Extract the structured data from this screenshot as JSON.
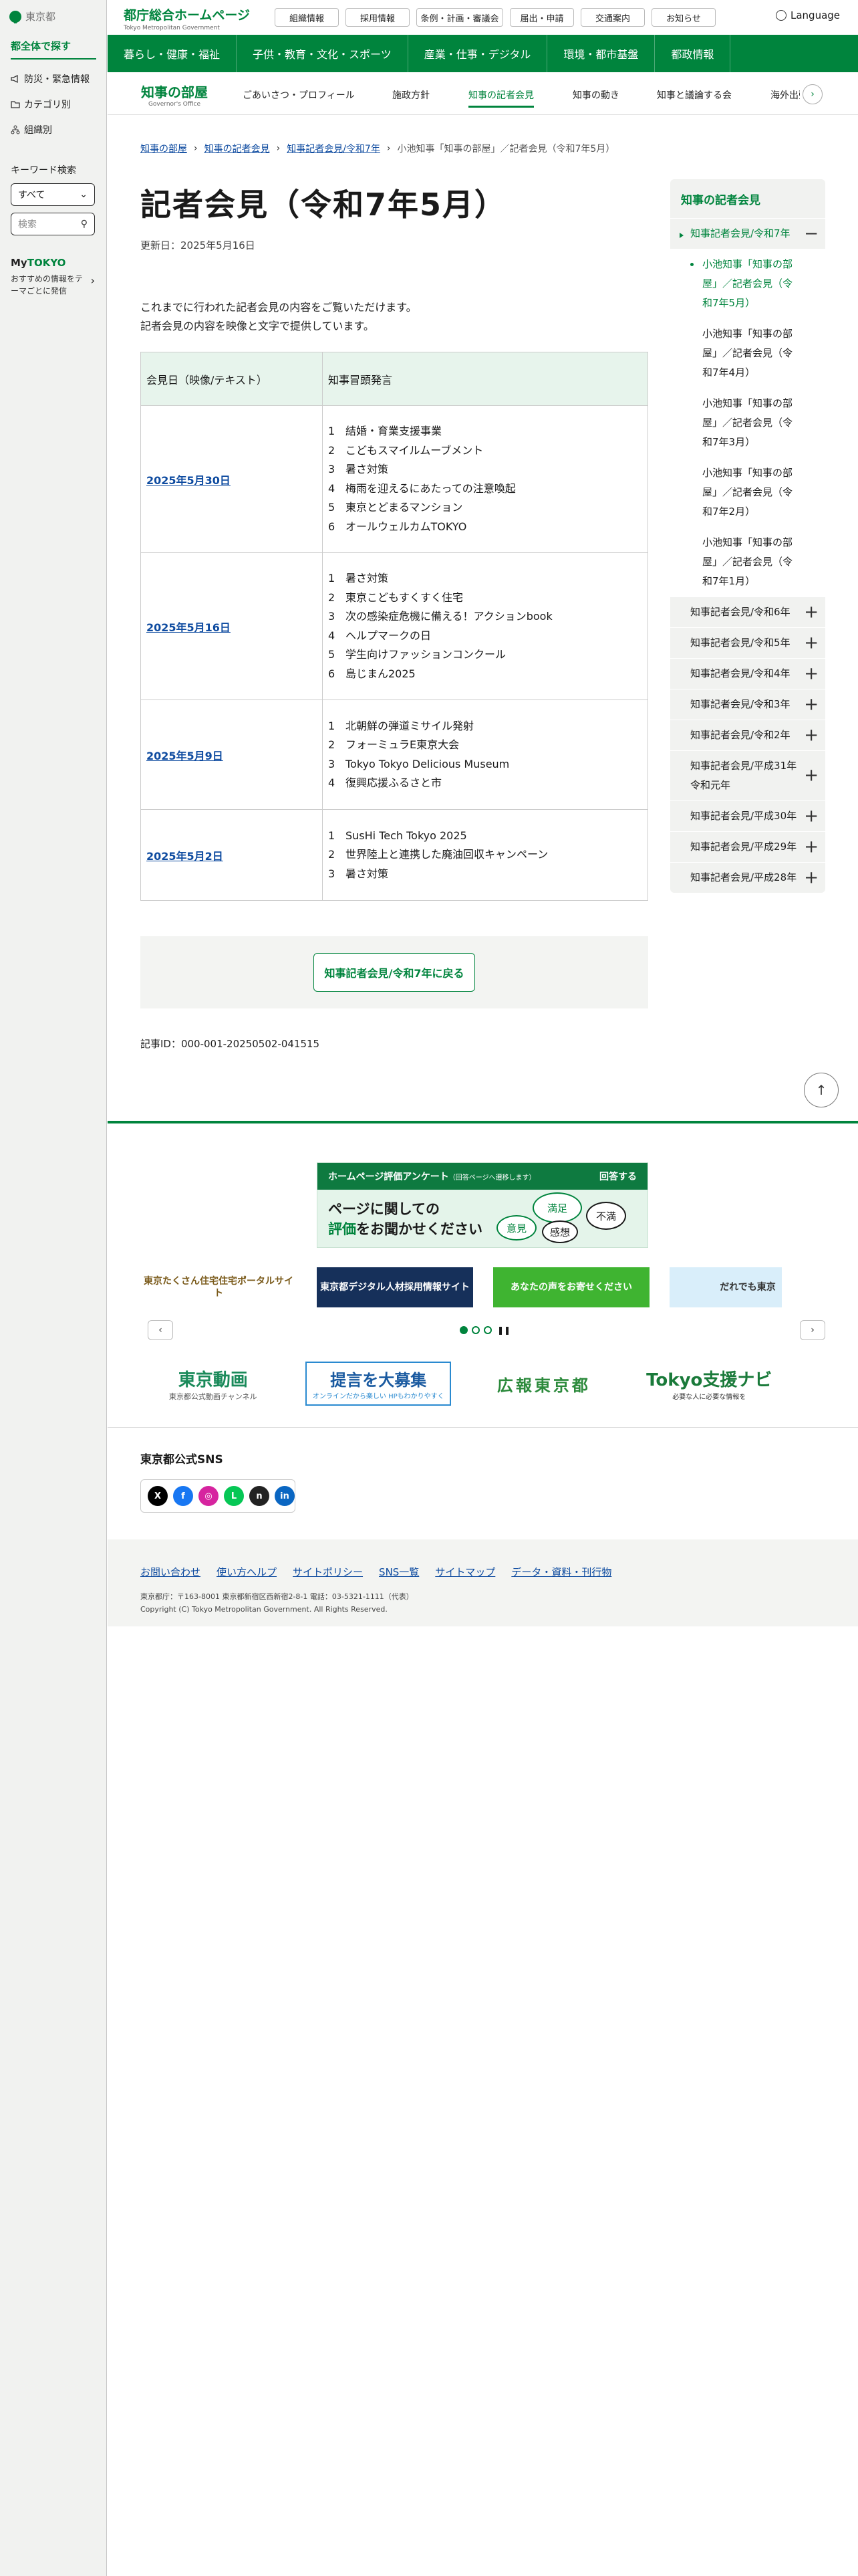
{
  "sidebar": {
    "logo_text": "東京都",
    "title": "都全体で探す",
    "links": [
      "防災・緊急情報",
      "カテゴリ別",
      "組織別"
    ],
    "keyword_label": "キーワード検索",
    "select_value": "すべて",
    "search_placeholder": "検索",
    "mytokyo_my": "My",
    "mytokyo_tokyo": "TOKYO",
    "mytokyo_desc": "おすすめの情報をテーマごとに発信"
  },
  "header": {
    "brand": "都庁総合ホームページ",
    "brand_en": "Tokyo Metropolitan Government",
    "buttons": [
      "組織情報",
      "採用情報",
      "条例・計画・審議会",
      "届出・申請",
      "交通案内",
      "お知らせ"
    ],
    "language": "Language"
  },
  "global_nav": [
    "暮らし・健康・福祉",
    "子供・教育・文化・スポーツ",
    "産業・仕事・デジタル",
    "環境・都市基盤",
    "都政情報"
  ],
  "sub_nav": {
    "title": "知事の部屋",
    "title_en": "Governor's Office",
    "items": [
      "ごあいさつ・プロフィール",
      "施政方針",
      "知事の記者会見",
      "知事の動き",
      "知事と議論する会",
      "海外出張"
    ],
    "active_index": 2
  },
  "breadcrumb": [
    "知事の部屋",
    "知事の記者会見",
    "知事記者会見/令和7年",
    "小池知事「知事の部屋」／記者会見（令和7年5月）"
  ],
  "page": {
    "title": "記者会見（令和7年5月）",
    "updated": "更新日：2025年5月16日",
    "intro_1": "これまでに行われた記者会見の内容をご覧いただけます。",
    "intro_2": "記者会見の内容を映像と文字で提供しています。",
    "table_headers": [
      "会見日（映像/テキスト）",
      "知事冒頭発言"
    ],
    "rows": [
      {
        "date": "2025年5月30日",
        "items": [
          "結婚・育業支援事業",
          "こどもスマイルムーブメント",
          "暑さ対策",
          "梅雨を迎えるにあたっての注意喚起",
          "東京とどまるマンション",
          "オールウェルカムTOKYO"
        ]
      },
      {
        "date": "2025年5月16日",
        "items": [
          "暑さ対策",
          "東京こどもすくすく住宅",
          "次の感染症危機に備える！アクションbook",
          "ヘルプマークの日",
          "学生向けファッションコンクール",
          "島じまん2025"
        ]
      },
      {
        "date": "2025年5月9日",
        "items": [
          "北朝鮮の弾道ミサイル発射",
          "フォーミュラE東京大会",
          "Tokyo Tokyo Delicious Museum",
          "復興応援ふるさと市"
        ]
      },
      {
        "date": "2025年5月2日",
        "items": [
          "SusHi Tech Tokyo 2025",
          "世界陸上と連携した廃油回収キャンペーン",
          "暑さ対策"
        ]
      }
    ],
    "back_button": "知事記者会見/令和7年に戻る",
    "page_id": "記事ID：000-001-20250502-041515"
  },
  "right_nav": {
    "heading": "知事の記者会見",
    "open_year": "知事記者会見/令和7年",
    "months": [
      "小池知事「知事の部屋」／記者会見（令和7年5月）",
      "小池知事「知事の部屋」／記者会見（令和7年4月）",
      "小池知事「知事の部屋」／記者会見（令和7年3月）",
      "小池知事「知事の部屋」／記者会見（令和7年2月）",
      "小池知事「知事の部屋」／記者会見（令和7年1月）"
    ],
    "years": [
      "知事記者会見/令和6年",
      "知事記者会見/令和5年",
      "知事記者会見/令和4年",
      "知事記者会見/令和3年",
      "知事記者会見/令和2年",
      "知事記者会見/平成31年　令和元年",
      "知事記者会見/平成30年",
      "知事記者会見/平成29年",
      "知事記者会見/平成28年"
    ]
  },
  "survey": {
    "header": "ホームページ評価アンケート",
    "header_note": "（回答ページへ遷移します）",
    "answer": "回答する",
    "line1": "ページに関しての",
    "line2_em": "評価",
    "line2": "をお聞かせください",
    "bubbles": [
      "満足",
      "意見",
      "感想",
      "不満"
    ]
  },
  "banners": [
    {
      "text": "東京たくさん住宅住宅ポータルサイト",
      "bg": "#ffffff",
      "fg": "#7a5a1a"
    },
    {
      "text": "東京都デジタル人材採用情報サイト",
      "bg": "#16305a",
      "fg": "#ffffff"
    },
    {
      "text": "あなたの声をお寄せください",
      "bg": "#3fb431",
      "fg": "#ffffff"
    },
    {
      "text": "だれでも東京",
      "bg": "#d9eefa",
      "fg": "#333333"
    }
  ],
  "banners2": [
    {
      "text": "東京動画",
      "sub": "東京都公式動画チャンネル",
      "fg": "#1a8a5a"
    },
    {
      "text": "提言を大募集",
      "sub": "オンラインだから楽しい HPもわかりやすく",
      "fg": "#1a5aa0"
    },
    {
      "text": "広報東京都",
      "sub": "",
      "fg": "#2c8a3c"
    },
    {
      "text": "Tokyo支援ナビ",
      "sub": "必要な人に必要な情報を",
      "fg": "#1a7a3a"
    }
  ],
  "sns_heading": "東京都公式SNS",
  "sns": [
    {
      "name": "x-icon",
      "glyph": "X",
      "bg": "#000000"
    },
    {
      "name": "facebook-icon",
      "glyph": "f",
      "bg": "#1877f2"
    },
    {
      "name": "instagram-icon",
      "glyph": "◎",
      "bg": "#d6249f"
    },
    {
      "name": "line-icon",
      "glyph": "L",
      "bg": "#06c755"
    },
    {
      "name": "note-icon",
      "glyph": "n",
      "bg": "#222222"
    },
    {
      "name": "linkedin-icon",
      "glyph": "in",
      "bg": "#0a66c2"
    }
  ],
  "footer": {
    "links": [
      "お問い合わせ",
      "使い方ヘルプ",
      "サイトポリシー",
      "SNS一覧",
      "サイトマップ",
      "データ・資料・刊行物"
    ],
    "address": "東京都庁：〒163-8001 東京都新宿区西新宿2-8-1 電話：03-5321-1111（代表）",
    "copyright": "Copyright (C) Tokyo Metropolitan Government. All Rights Reserved."
  }
}
